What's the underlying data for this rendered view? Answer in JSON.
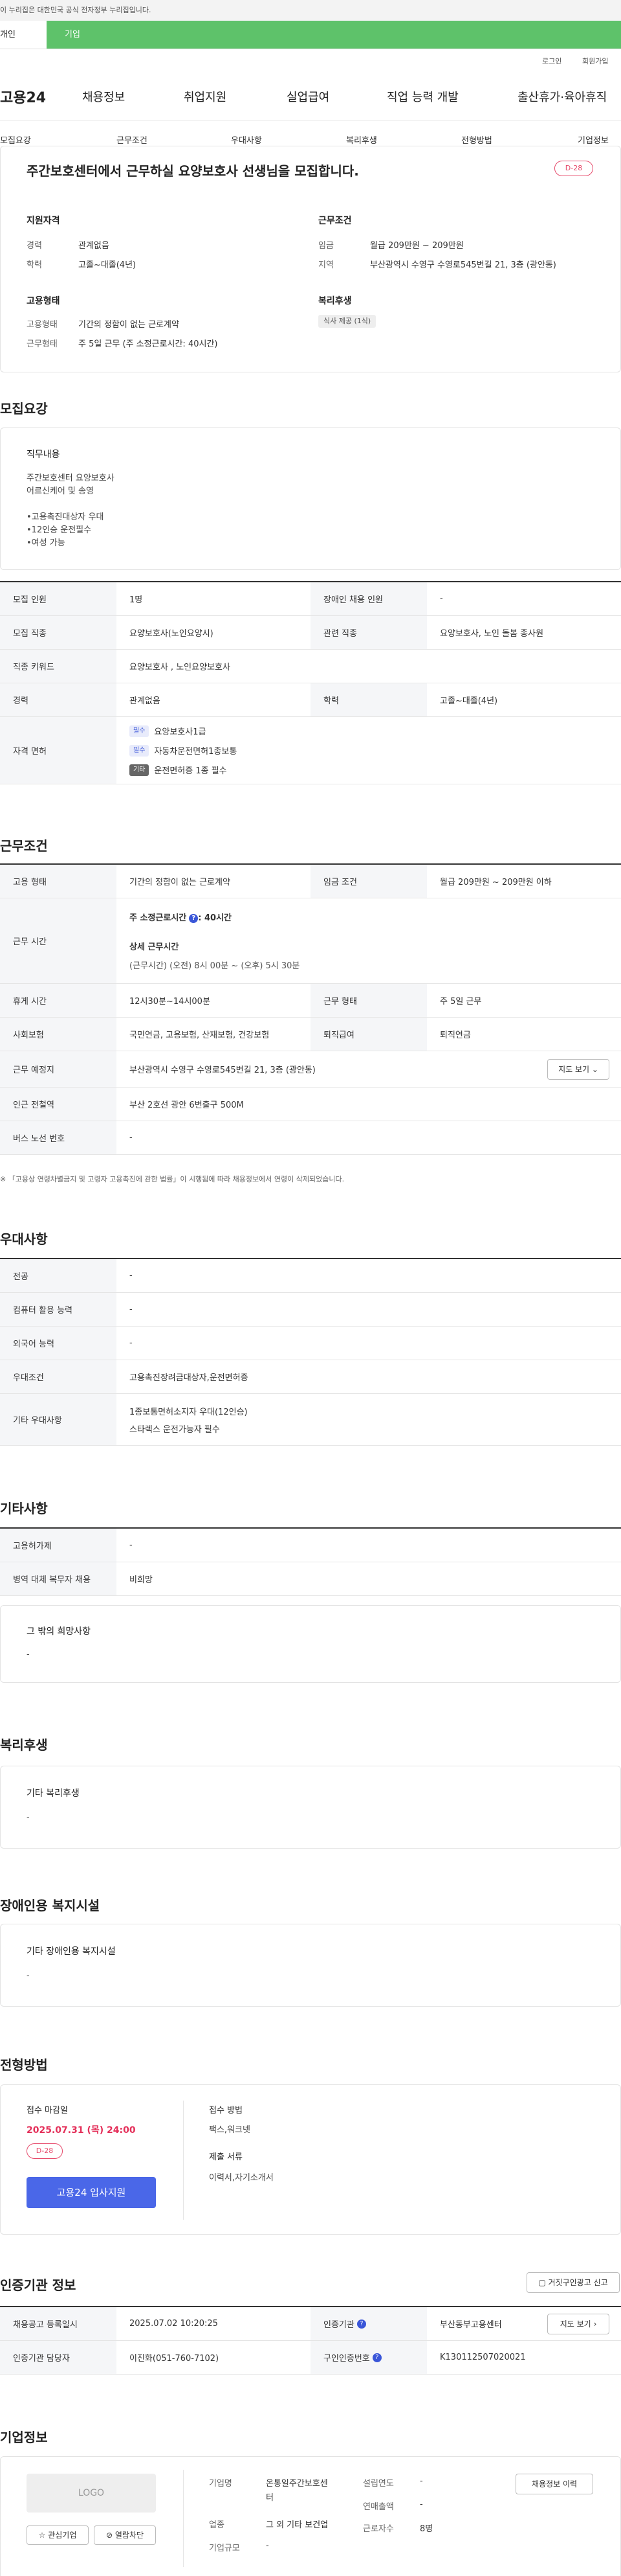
{
  "gov_notice": "이 누리집은 대한민국 공식 전자정부 누리집입니다.",
  "segment": {
    "personal": "개인",
    "company": "기업"
  },
  "util": {
    "login": "로그인",
    "signup": "회원가입"
  },
  "gnb": {
    "logo": "고용24",
    "menus": [
      "채용정보",
      "취업지원",
      "실업급여",
      "직업 능력 개발",
      "출산휴가·육아휴직"
    ]
  },
  "snb": [
    "모집요강",
    "근무조건",
    "우대사항",
    "복리후생",
    "전형방법",
    "기업정보"
  ],
  "summary": {
    "title": "주간보호센터에서 근무하실 요양보호사 선생님을 모집합니다.",
    "dday": "D-28",
    "qual": {
      "title": "지원자격",
      "career_k": "경력",
      "career_v": "관계없음",
      "edu_k": "학력",
      "edu_v": "고졸~대졸(4년)"
    },
    "cond": {
      "title": "근무조건",
      "wage_k": "임금",
      "wage_v": "월급 209만원 ~ 209만원",
      "loc_k": "지역",
      "loc_v": "부산광역시 수영구 수영로545번길 21, 3층 (광안동)"
    },
    "emp": {
      "title": "고용형태",
      "type_k": "고용형태",
      "type_v": "기간의 정함이 없는 근로계약",
      "form_k": "근무형태",
      "form_v": "주 5일 근무 (주 소정근로시간: 40시간)"
    },
    "welfare": {
      "title": "복리후생",
      "tag": "식사 제공 (1식)"
    }
  },
  "recruit": {
    "heading": "모집요강",
    "job_title": "직무내용",
    "job_lines": [
      "주간보호센터 요양보호사",
      "어르신케어 및 송영",
      "",
      "•고용촉진대상자 우대",
      "•12인승 운전필수",
      "•여성 가능"
    ],
    "rows": {
      "count_k": "모집 인원",
      "count_v": "1명",
      "disabled_k": "장애인 채용 인원",
      "disabled_v": "-",
      "job_k": "모집 직종",
      "job_v": "요양보호사(노인요양시)",
      "related_k": "관련 직종",
      "related_v": "요양보호사, 노인 돌봄 종사원",
      "kw_k": "직종 키워드",
      "kw_v": "요양보호사 , 노인요양보호사",
      "career_k": "경력",
      "career_v": "관계없음",
      "edu_k": "학력",
      "edu_v": "고졸~대졸(4년)",
      "lic_k": "자격 면허",
      "lic": [
        {
          "tag": "필수",
          "name": "요양보호사1급"
        },
        {
          "tag": "필수",
          "name": "자동차운전면허1종보통"
        },
        {
          "tag": "기타",
          "name": "운전면허증 1종 필수"
        }
      ]
    }
  },
  "work": {
    "heading": "근무조건",
    "type_k": "고용 형태",
    "type_v": "기간의 정함이 없는 근로계약",
    "wage_k": "임금 조건",
    "wage_v": "월급 209만원 ~ 209만원 이하",
    "time_k": "근무 시간",
    "time_main": "주 소정근로시간",
    "time_main_val": ": 40시간",
    "time_detail_title": "상세 근무시간",
    "time_detail": "(근무시간) (오전) 8시 00분 ~ (오후) 5시 30분",
    "rest_k": "휴게 시간",
    "rest_v": "12시30분~14시00분",
    "form_k": "근무 형태",
    "form_v": "주 5일 근무",
    "ins_k": "사회보험",
    "ins_v": "국민연금, 고용보험, 산재보험, 건강보험",
    "ret_k": "퇴직급여",
    "ret_v": "퇴직연금",
    "place_k": "근무 예정지",
    "place_v": "부산광역시 수영구 수영로545번길 21, 3층 (광안동)",
    "map_btn": "지도 보기",
    "subway_k": "인근 전철역",
    "subway_v": "부산 2호선 광안 6번출구 500M",
    "bus_k": "버스 노선 번호",
    "bus_v": "-",
    "note": "※ 「고용상 연령차별금지 및 고령자 고용촉진에 관한 법률」이 시행됨에 따라 채용정보에서 연령이 삭제되었습니다."
  },
  "pref": {
    "heading": "우대사항",
    "rows": [
      {
        "k": "전공",
        "v": "-"
      },
      {
        "k": "컴퓨터 활용 능력",
        "v": "-"
      },
      {
        "k": "외국어 능력",
        "v": "-"
      },
      {
        "k": "우대조건",
        "v": "고용촉진장려금대상자,운전면허증"
      },
      {
        "k": "기타 우대사항",
        "v": "1종보통면허소지자 우대(12인승)",
        "v2": "스타렉스 운전가능자 필수"
      }
    ]
  },
  "etc": {
    "heading": "기타사항",
    "rows": [
      {
        "k": "고용허가제",
        "v": "-"
      },
      {
        "k": "병역 대체 복무자 채용",
        "v": "비희망"
      }
    ],
    "wish_title": "그 밖의 희망사항",
    "wish_v": "-"
  },
  "welfare": {
    "heading": "복리후생",
    "title": "기타 복리후생",
    "v": "-"
  },
  "facility": {
    "heading": "장애인용 복지시설",
    "title": "기타 장애인용 복지시설",
    "v": "-"
  },
  "process": {
    "heading": "전형방법",
    "deadline_k": "접수 마감일",
    "deadline_v": "2025.07.31 (목) 24:00",
    "dday": "D-28",
    "apply_btn": "고용24 입사지원",
    "method_k": "접수 방법",
    "method_v": "팩스,워크넷",
    "docs_k": "제출 서류",
    "docs_v": "이력서,자기소개서"
  },
  "agency": {
    "heading": "인증기관 정보",
    "report_btn": "거짓구인광고 신고",
    "reg_k": "채용공고 등록일시",
    "reg_v": "2025.07.02 10:20:25",
    "org_k": "인증기관",
    "org_v": "부산동부고용센터",
    "map_btn": "지도 보기",
    "mgr_k": "인증기관 담당자",
    "mgr_v": "이진화(051-760-7102)",
    "no_k": "구인인증번호",
    "no_v": "K130112507020021"
  },
  "company": {
    "heading": "기업정보",
    "logo": "LOGO",
    "fav_btn": "관심기업",
    "block_btn": "열람차단",
    "name_k": "기업명",
    "name_v1": "온통일주간보호센",
    "name_v2": "터",
    "ind_k": "업종",
    "ind_v": "그 외 기타 보건업",
    "size_k": "기업규모",
    "size_v": "-",
    "year_k": "설립연도",
    "year_v": "-",
    "sales_k": "연매출액",
    "sales_v": "-",
    "emp_k": "근로자수",
    "emp_v": "8명",
    "history_btn": "채용정보 이력"
  }
}
